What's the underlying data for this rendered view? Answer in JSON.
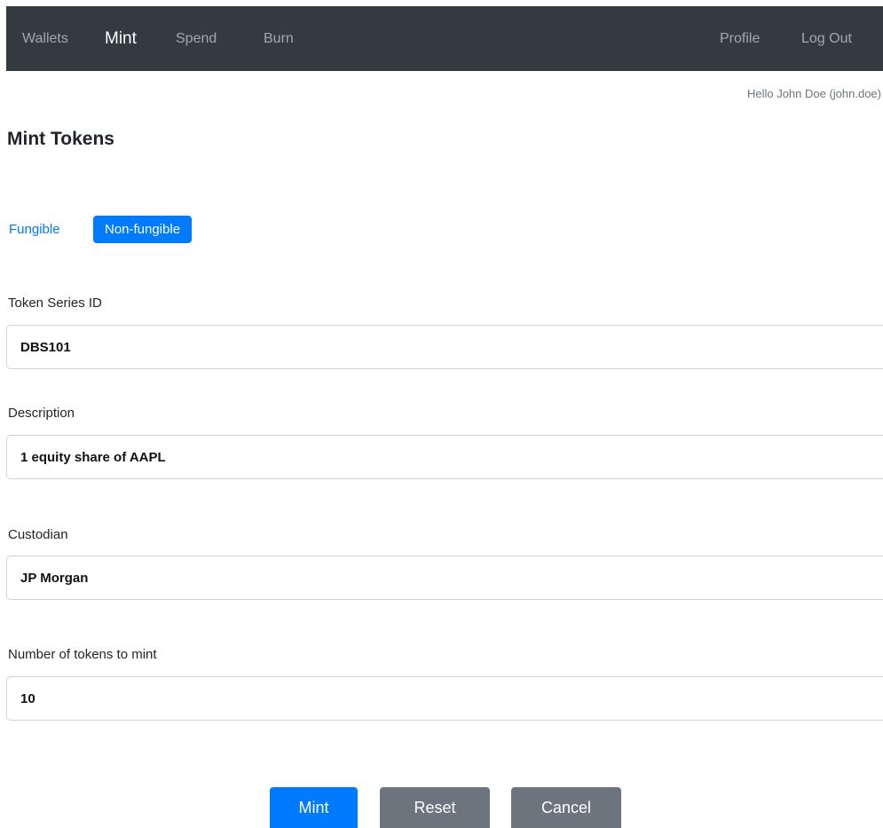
{
  "navbar": {
    "left_items": [
      {
        "label": "Wallets",
        "active": false
      },
      {
        "label": "Mint",
        "active": true
      },
      {
        "label": "Spend",
        "active": false
      },
      {
        "label": "Burn",
        "active": false
      }
    ],
    "right_items": [
      {
        "label": "Profile"
      },
      {
        "label": "Log Out"
      }
    ]
  },
  "greeting": "Hello John Doe (john.doe)",
  "page_title": "Mint Tokens",
  "token_type": {
    "options": [
      "Fungible",
      "Non-fungible"
    ],
    "selected": "Non-fungible"
  },
  "form": {
    "token_series_id": {
      "label": "Token Series ID",
      "value": "DBS101"
    },
    "description": {
      "label": "Description",
      "value": "1 equity share of AAPL"
    },
    "custodian": {
      "label": "Custodian",
      "value": "JP Morgan"
    },
    "num_tokens": {
      "label": "Number of tokens to mint",
      "value": "10"
    }
  },
  "actions": {
    "mint_label": "Mint",
    "reset_label": "Reset",
    "cancel_label": "Cancel"
  },
  "colors": {
    "navbar_bg": "#343a40",
    "primary": "#007bff",
    "secondary": "#6c757d"
  }
}
